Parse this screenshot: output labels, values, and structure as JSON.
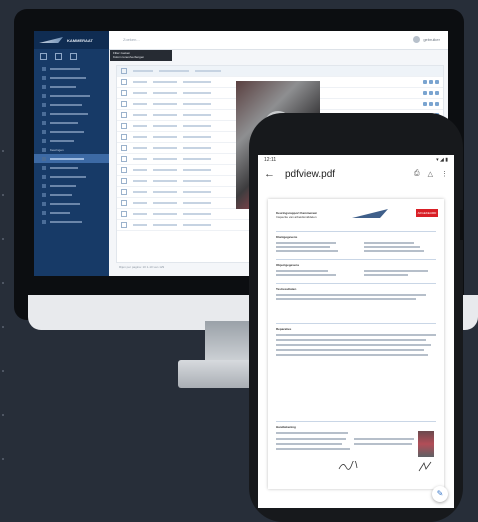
{
  "desktop": {
    "brand": "KAMMERAAT",
    "search_placeholder": "Zoeken...",
    "user_name": "gebruiker",
    "tooltip_lines": [
      "Filter zoeken",
      "Kolom tonen/verbergen"
    ],
    "sidebar_active": "Keuringen",
    "table_footer": "Rijen per pagina: 10   1-10 van 129"
  },
  "phone": {
    "status_time": "12:11",
    "status_icons": "▾ ◢ ▮",
    "title": "pdfview.pdf",
    "report": {
      "company_line1": "Keuringsrapport Kammeraat",
      "company_line2": "Inspectie van arbeidsmiddelen",
      "section_client": "Klantgegevens",
      "section_object": "Objectgegevens",
      "section_test": "Testresultaten",
      "section_repairs": "Reparaties",
      "section_sign": "Handtekening",
      "red_button": "AFGEKEURD"
    }
  },
  "colors": {
    "sidebar": "#173a67",
    "accent": "#3d6aa5",
    "background": "#272e39",
    "reject_red": "#d91f26"
  }
}
